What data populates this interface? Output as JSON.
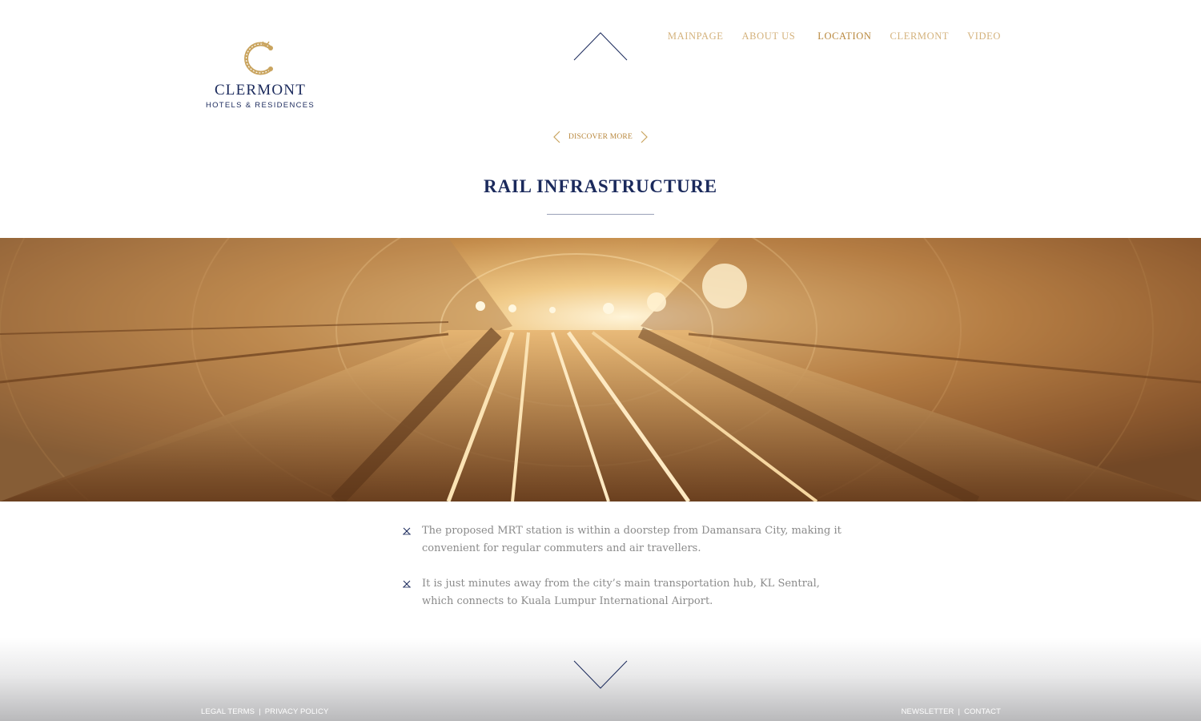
{
  "brand": {
    "name": "CLERMONT",
    "tagline": "HOTELS & RESIDENCES",
    "logo_icon": "clermont-c-monogram",
    "accent_color": "#c9a45f",
    "navy_color": "#1b2a5c"
  },
  "nav": {
    "items": [
      {
        "label": "MAINPAGE",
        "active": false
      },
      {
        "label": "ABOUT US",
        "active": false
      },
      {
        "label": "LOCATION",
        "active": true
      },
      {
        "label": "CLERMONT",
        "active": false
      },
      {
        "label": "VIDEO",
        "active": false
      }
    ]
  },
  "scroll": {
    "up_icon": "chevron-up-icon",
    "down_icon": "chevron-down-icon"
  },
  "discover": {
    "label": "DISCOVER MORE",
    "prev_icon": "chevron-left-icon",
    "next_icon": "chevron-right-icon"
  },
  "section": {
    "title": "RAIL INFRASTRUCTURE",
    "hero_image": "rail tunnel photo",
    "bullets": [
      "The proposed MRT station is within a doorstep from Damansara City, making it convenient for regular commuters and air travellers.",
      "It is just minutes away from the city’s main transportation hub, KL Sentral, which connects to Kuala Lumpur International Airport."
    ],
    "bullet_icon": "cross-bullet-icon"
  },
  "footer": {
    "left": [
      "LEGAL TERMS",
      "PRIVACY POLICY"
    ],
    "right": [
      "NEWSLETTER",
      "CONTACT"
    ],
    "separator": "|"
  }
}
